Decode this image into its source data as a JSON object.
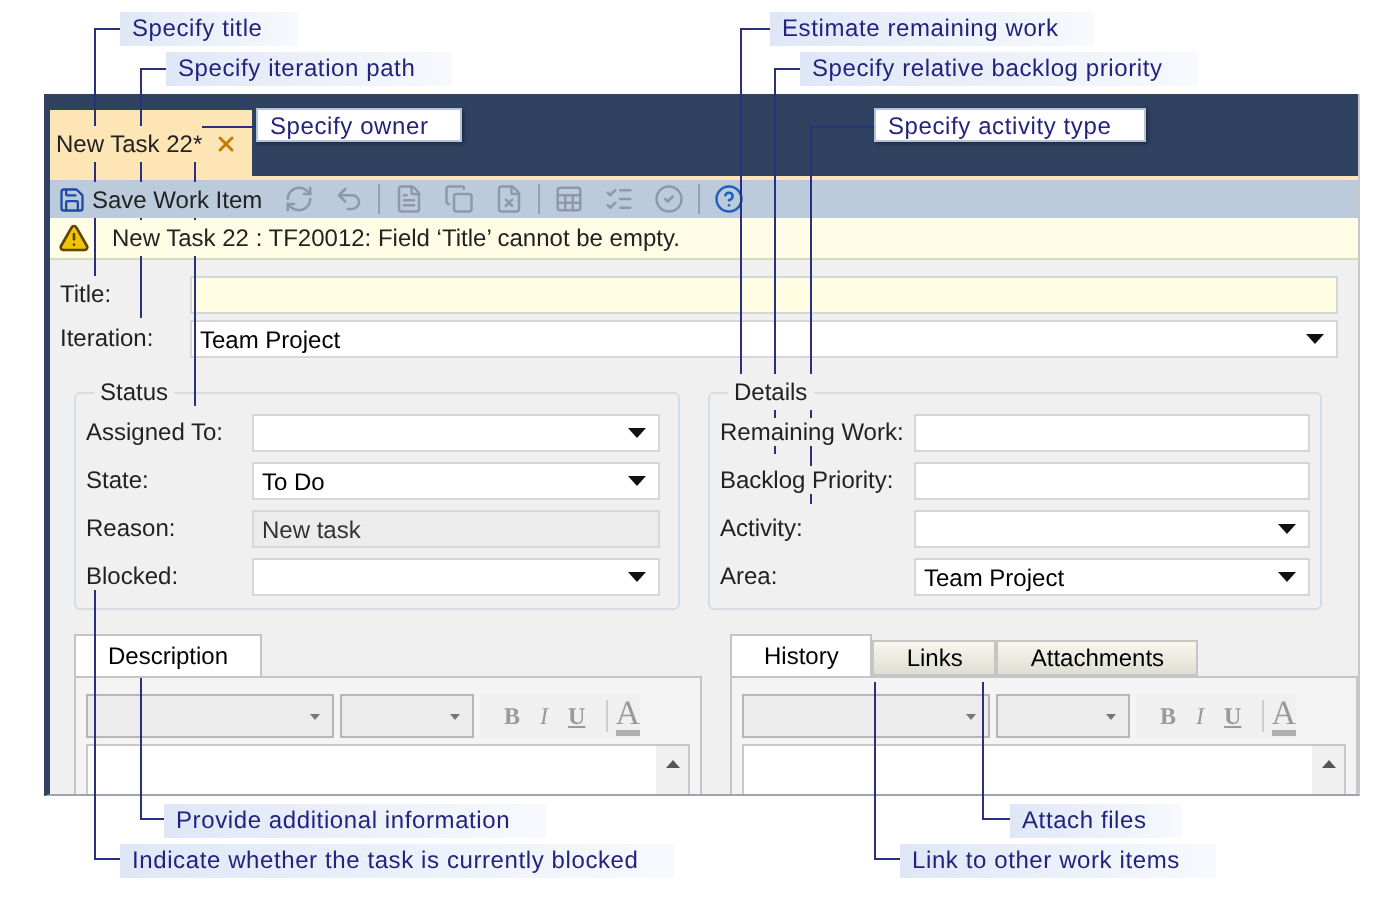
{
  "callouts": [
    {
      "text": "Specify title"
    },
    {
      "text": "Specify iteration path"
    },
    {
      "text": "Specify owner"
    },
    {
      "text": "Estimate remaining work"
    },
    {
      "text": "Specify relative backlog priority"
    },
    {
      "text": "Specify activity type"
    },
    {
      "text": "Provide additional information"
    },
    {
      "text": "Indicate whether the task is currently blocked"
    },
    {
      "text": "Attach files"
    },
    {
      "text": "Link to other work items"
    }
  ],
  "document_tab": {
    "label": "New Task 22*"
  },
  "toolbar": {
    "save_label": "Save Work Item",
    "groups": [
      [
        {
          "kind": "refresh",
          "disabled": true
        },
        {
          "kind": "undo",
          "disabled": true
        }
      ],
      [
        {
          "kind": "document",
          "disabled": true
        },
        {
          "kind": "copy",
          "disabled": true
        },
        {
          "kind": "document-x",
          "disabled": true
        }
      ],
      [
        {
          "kind": "spreadsheet",
          "disabled": true
        },
        {
          "kind": "list",
          "disabled": true
        },
        {
          "kind": "check",
          "disabled": true
        }
      ],
      [
        {
          "kind": "help",
          "disabled": false
        }
      ]
    ]
  },
  "warning": {
    "message": "New Task 22 : TF20012: Field ‘Title’ cannot be empty."
  },
  "top_fields": [
    {
      "kind": "text",
      "label": "Title:",
      "invalid": true
    },
    {
      "kind": "dropdown",
      "label": "Iteration:",
      "value": "Team Project"
    }
  ],
  "groups": [
    {
      "legend": "Status",
      "fields": [
        {
          "kind": "dropdown",
          "label": "Assigned To:"
        },
        {
          "kind": "dropdown",
          "label": "State:",
          "value": "To Do"
        },
        {
          "kind": "readonly",
          "label": "Reason:",
          "value": "New task"
        },
        {
          "kind": "dropdown",
          "label": "Blocked:"
        }
      ]
    },
    {
      "legend": "Details",
      "fields": [
        {
          "kind": "text",
          "label": "Remaining Work:"
        },
        {
          "kind": "text",
          "label": "Backlog Priority:"
        },
        {
          "kind": "dropdown",
          "label": "Activity:"
        },
        {
          "kind": "dropdown",
          "label": "Area:",
          "value": "Team Project"
        }
      ]
    }
  ],
  "panels": [
    {
      "tabs": [
        {
          "label": "Description",
          "selected": true
        }
      ],
      "format_buttons": [
        "B",
        "I",
        "U",
        "A"
      ]
    },
    {
      "tabs": [
        {
          "label": "History",
          "selected": true
        },
        {
          "label": "Links",
          "selected": false
        },
        {
          "label": "Attachments",
          "selected": false
        }
      ],
      "format_buttons": [
        "B",
        "I",
        "U",
        "A"
      ]
    }
  ]
}
